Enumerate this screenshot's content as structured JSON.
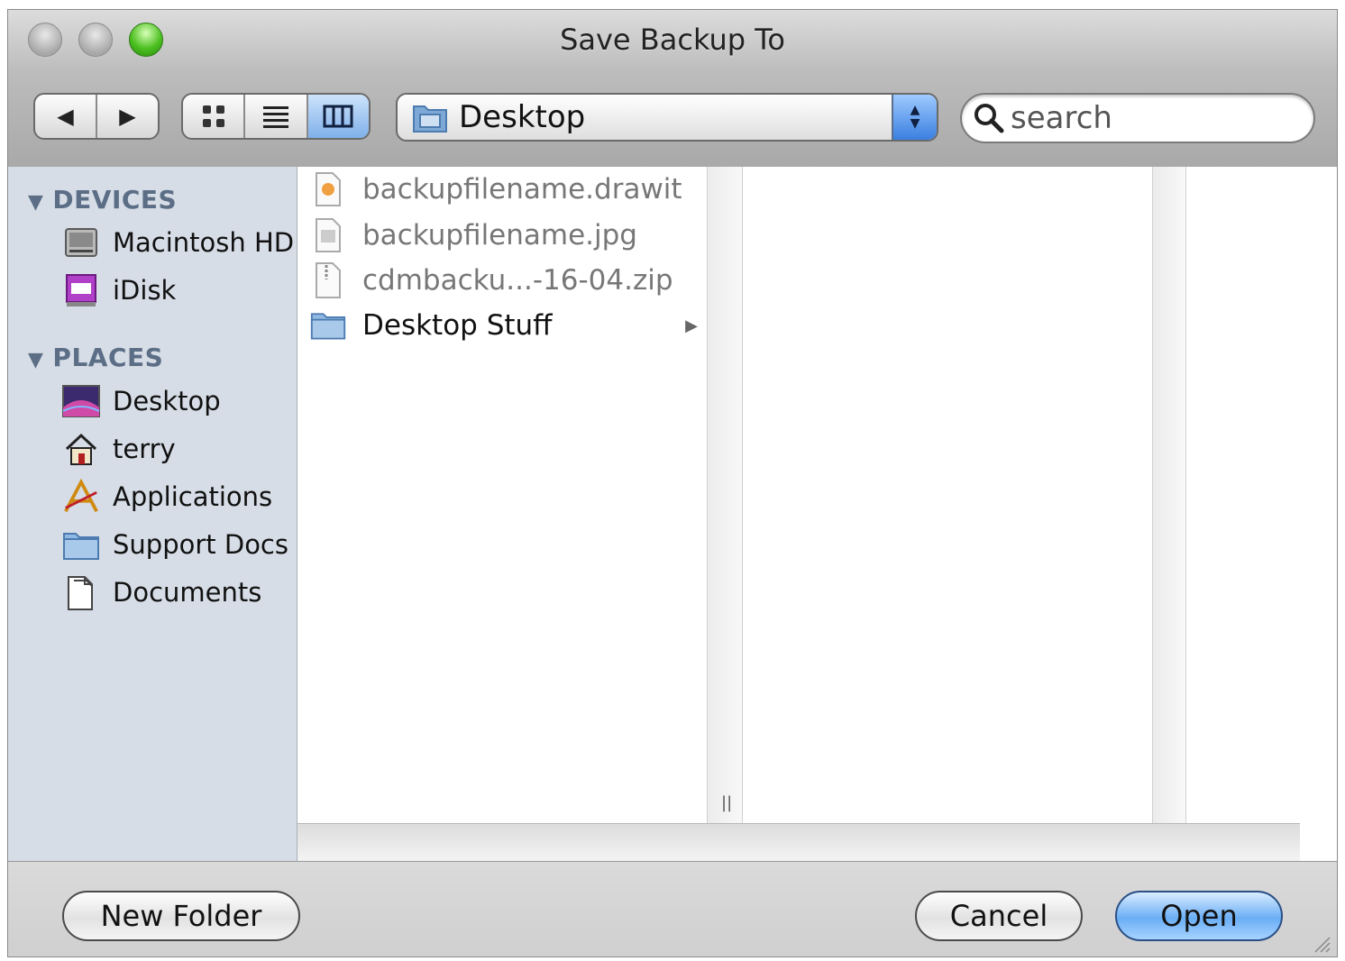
{
  "window": {
    "title": "Save Backup To"
  },
  "toolbar": {
    "back_glyph": "◀",
    "forward_glyph": "▶",
    "view_modes": [
      "icon-view",
      "list-view",
      "column-view"
    ],
    "location": "Desktop",
    "search_placeholder": "search"
  },
  "sidebar": {
    "devices_heading": "DEVICES",
    "devices": [
      {
        "label": "Macintosh HD",
        "icon": "hard-drive-icon"
      },
      {
        "label": "iDisk",
        "icon": "idisk-icon"
      }
    ],
    "places_heading": "PLACES",
    "places": [
      {
        "label": "Desktop",
        "icon": "desktop-icon"
      },
      {
        "label": "terry",
        "icon": "home-icon"
      },
      {
        "label": "Applications",
        "icon": "applications-icon"
      },
      {
        "label": "Support Docs",
        "icon": "folder-icon"
      },
      {
        "label": "Documents",
        "icon": "documents-icon"
      }
    ]
  },
  "files": [
    {
      "name": "backupfilename.drawit",
      "icon": "drawit-file-icon",
      "enabled": false
    },
    {
      "name": "backupfilename.jpg",
      "icon": "jpg-file-icon",
      "enabled": false
    },
    {
      "name": "cdmbacku...-16-04.zip",
      "icon": "zip-file-icon",
      "enabled": false
    },
    {
      "name": "Desktop Stuff",
      "icon": "folder-icon",
      "enabled": true
    }
  ],
  "buttons": {
    "new_folder": "New Folder",
    "cancel": "Cancel",
    "open": "Open"
  },
  "colors": {
    "sidebar_bg": "#d6dde6",
    "section_heading": "#5b6e86",
    "primary_button": "#6aaef5"
  }
}
